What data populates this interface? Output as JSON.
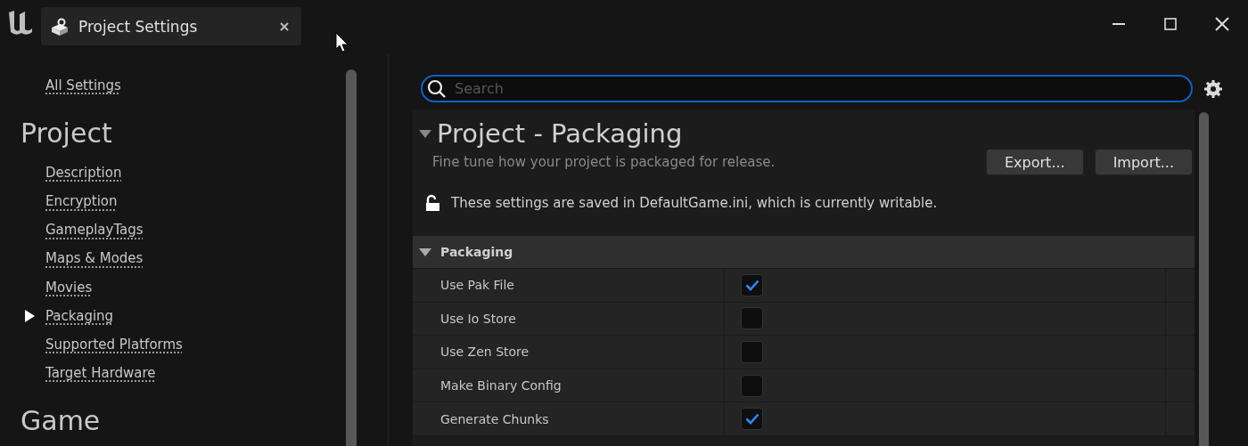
{
  "tab": {
    "title": "Project Settings"
  },
  "sidebar": {
    "all_settings": "All Settings",
    "sections": [
      {
        "heading": "Project",
        "items": [
          {
            "label": "Description",
            "selected": false
          },
          {
            "label": "Encryption",
            "selected": false
          },
          {
            "label": "GameplayTags",
            "selected": false
          },
          {
            "label": "Maps & Modes",
            "selected": false
          },
          {
            "label": "Movies",
            "selected": false
          },
          {
            "label": "Packaging",
            "selected": true
          },
          {
            "label": "Supported Platforms",
            "selected": false
          },
          {
            "label": "Target Hardware",
            "selected": false
          }
        ]
      },
      {
        "heading": "Game"
      }
    ]
  },
  "search": {
    "placeholder": "Search"
  },
  "page": {
    "title": "Project - Packaging",
    "description": "Fine tune how your project is packaged for release.",
    "buttons": [
      "Export...",
      "Import..."
    ],
    "notice": "These settings are saved in DefaultGame.ini, which is currently writable."
  },
  "category": {
    "title": "Packaging",
    "expanded": true,
    "rows": [
      {
        "label": "Use Pak File",
        "checked": true
      },
      {
        "label": "Use Io Store",
        "checked": false
      },
      {
        "label": "Use Zen Store",
        "checked": false
      },
      {
        "label": "Make Binary Config",
        "checked": false
      },
      {
        "label": "Generate Chunks",
        "checked": true
      }
    ]
  }
}
